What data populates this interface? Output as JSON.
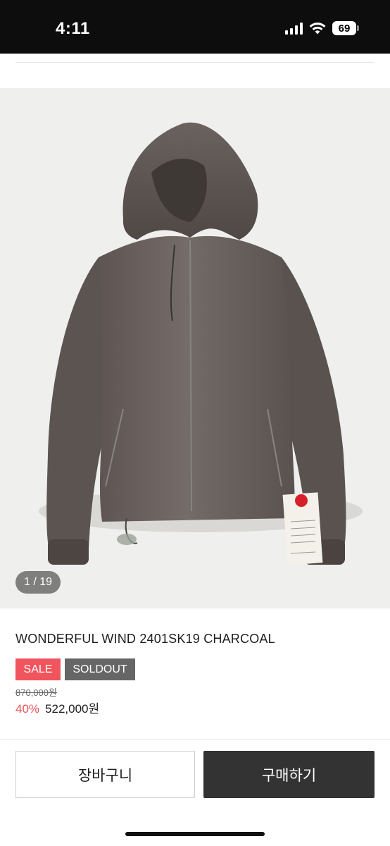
{
  "status_bar": {
    "time": "4:11",
    "battery": "69",
    "icons": [
      "signal-icon",
      "wifi-icon",
      "battery-icon"
    ]
  },
  "product": {
    "image_alt": "Charcoal hooded wind jacket",
    "image_counter": "1 / 19",
    "title": "WONDERFUL WIND 2401SK19 CHARCOAL",
    "badges": {
      "sale": "SALE",
      "soldout": "SOLDOUT"
    },
    "original_price": "870,000원",
    "discount": "40%",
    "sale_price": "522,000원"
  },
  "actions": {
    "cart_label": "장바구니",
    "buy_label": "구매하기"
  },
  "colors": {
    "status_bar_bg": "#0d0d0d",
    "sale_badge": "#f0545c",
    "soldout_badge": "#666666",
    "discount_text": "#e8525a",
    "buy_button": "#333333"
  }
}
